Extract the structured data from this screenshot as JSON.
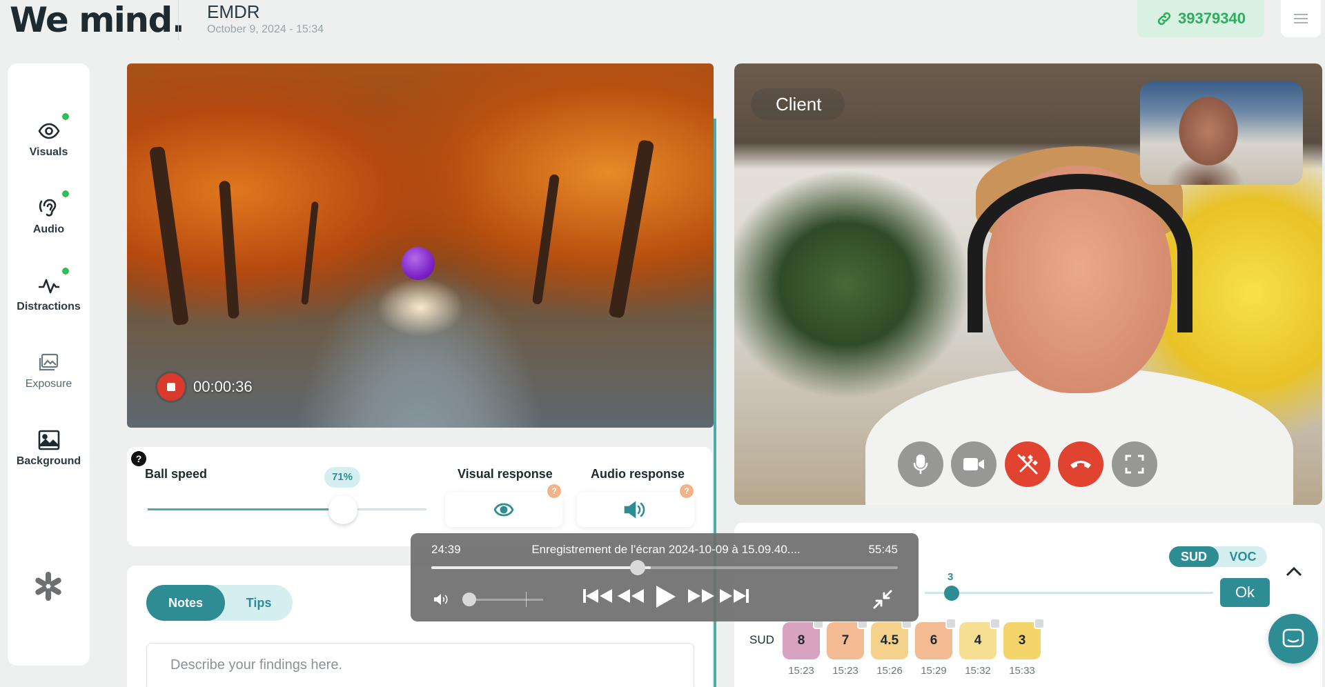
{
  "header": {
    "logo": "We mind.",
    "title": "EMDR",
    "date": "October 9, 2024 - 15:34",
    "session_code": "39379340",
    "icons": {
      "link": "link-icon",
      "menu": "hamburger-icon"
    }
  },
  "sidebar": {
    "items": [
      {
        "label": "Visuals",
        "icon": "eye-icon",
        "active": true
      },
      {
        "label": "Audio",
        "icon": "ear-icon",
        "active": true
      },
      {
        "label": "Distractions",
        "icon": "pulse-icon",
        "active": true
      },
      {
        "label": "Exposure",
        "icon": "gallery-icon",
        "active": false
      },
      {
        "label": "Background",
        "icon": "image-icon",
        "active": false
      }
    ],
    "footer_icon": "asterisk-logo-icon",
    "active_dot_color": "#2fbf5a"
  },
  "stimulus": {
    "recording_time": "00:00:36",
    "ball_color": "#7b1fc6"
  },
  "controls": {
    "help": "?",
    "ball_speed_label": "Ball speed",
    "ball_speed_value": "71%",
    "ball_speed_fraction": 0.71,
    "visual_response_label": "Visual response",
    "audio_response_label": "Audio response",
    "help_badge": "?"
  },
  "notes": {
    "tab_notes": "Notes",
    "tab_tips": "Tips",
    "placeholder": "Describe your findings here."
  },
  "call": {
    "participant_label": "Client",
    "controls": [
      "microphone-icon",
      "camera-icon",
      "magic-wand-icon",
      "hang-up-icon",
      "fullscreen-icon"
    ]
  },
  "sud": {
    "toggle_sud": "SUD",
    "toggle_voc": "VOC",
    "current_value": "3",
    "ok_label": "Ok",
    "row_label": "SUD",
    "entries": [
      {
        "value": "8",
        "time": "15:23",
        "color": "#d8a3c0"
      },
      {
        "value": "7",
        "time": "15:23",
        "color": "#f2bb94"
      },
      {
        "value": "4.5",
        "time": "15:26",
        "color": "#f4d28c"
      },
      {
        "value": "6",
        "time": "15:29",
        "color": "#f2bb94"
      },
      {
        "value": "4",
        "time": "15:32",
        "color": "#f6de92"
      },
      {
        "value": "3",
        "time": "15:33",
        "color": "#f3d56b"
      }
    ]
  },
  "player": {
    "current_time": "24:39",
    "title": "Enregistrement de l’écran 2024-10-09 à 15.09.40....",
    "remaining_time": "55:45",
    "progress_fraction": 0.47,
    "volume_fraction": 0.0
  },
  "colors": {
    "accent": "#2e8c94",
    "accent_light": "#d5eff1",
    "badge_green": "#2eae5c",
    "record_red": "#d93a2b",
    "hangup_red": "#e0432f"
  }
}
